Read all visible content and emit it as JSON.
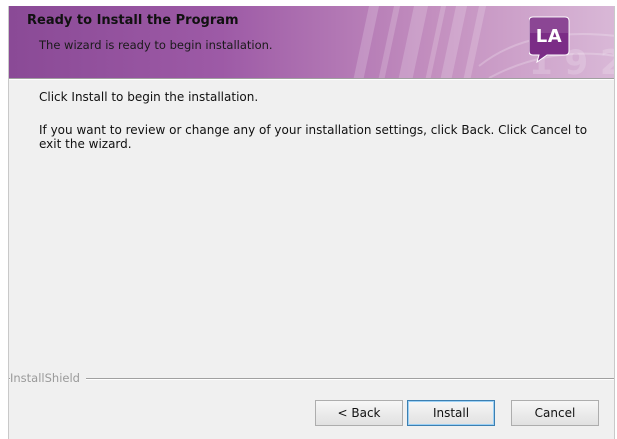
{
  "header": {
    "title": "Ready to Install the Program",
    "subtitle": "The wizard is ready to begin installation.",
    "logo_text": "LA",
    "logo_icon": "la-logo-icon",
    "accent_color": "#8a4a96",
    "logo_color": "#7b2d86"
  },
  "main": {
    "instruction": "Click Install to begin the installation.",
    "details": "If you want to review or change any of your installation settings, click Back. Click Cancel to exit the wizard."
  },
  "footer": {
    "brand": "InstallShield",
    "back_label": "< Back",
    "install_label": "Install",
    "cancel_label": "Cancel"
  }
}
